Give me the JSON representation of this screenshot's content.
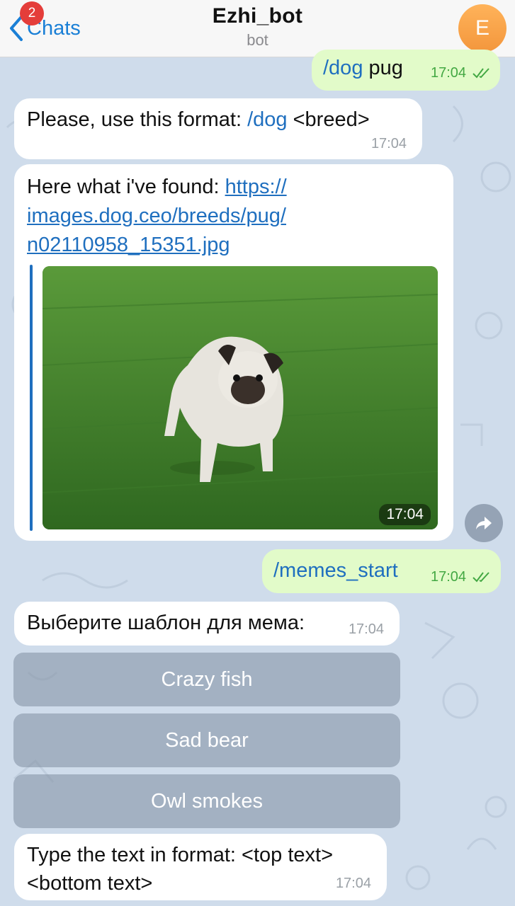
{
  "header": {
    "back_label": "Chats",
    "unread_count": "2",
    "title": "Ezhi_bot",
    "subtitle": "bot",
    "avatar_letter": "E"
  },
  "messages": {
    "m1": {
      "cmd": "/dog",
      "text": " pug",
      "time": "17:04"
    },
    "m2": {
      "text": "Please, use this format: ",
      "cmd": "/dog",
      "text2": " <breed>",
      "time": "17:04"
    },
    "m3": {
      "text": "Here what i've found: ",
      "link_line1": "https://",
      "link_line2": "images.dog.ceo/breeds/pug/",
      "link_line3": "n02110958_15351.jpg",
      "photo_time": "17:04"
    },
    "m4": {
      "text": "/memes_start",
      "time": "17:04"
    },
    "m5": {
      "text": "Выберите шаблон для мема:",
      "time": "17:04"
    },
    "m6": {
      "line1": "Type the text in format: <top text>",
      "line2": "<bottom text>",
      "time": "17:04"
    }
  },
  "keyboard": {
    "buttons": [
      "Crazy fish",
      "Sad bear",
      "Owl smokes"
    ]
  },
  "colors": {
    "accent": "#1a7fd6",
    "outgoing_bubble": "#e2fbc9",
    "incoming_bubble": "#ffffff",
    "wallpaper": "#cfdceb",
    "badge": "#e43d3a"
  }
}
